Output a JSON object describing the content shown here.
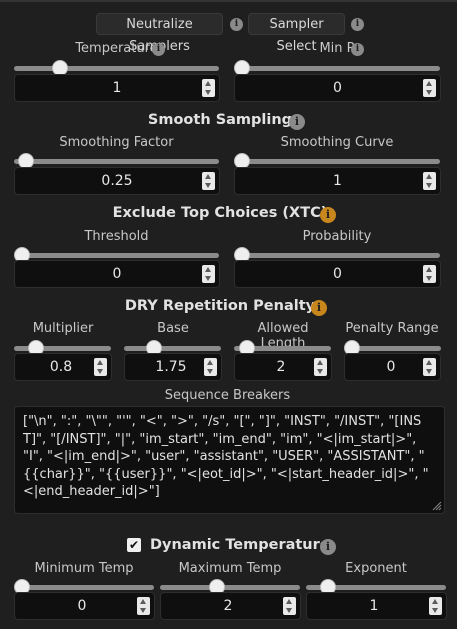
{
  "top_buttons": {
    "neutralize": "Neutralize Samplers",
    "sampler_select": "Sampler Select"
  },
  "basic": {
    "temperature": {
      "label": "Temperature",
      "value": "1"
    },
    "min_p": {
      "label": "Min P",
      "value": "0"
    }
  },
  "smooth": {
    "title": "Smooth Sampling",
    "factor": {
      "label": "Smoothing Factor",
      "value": "0.25"
    },
    "curve": {
      "label": "Smoothing Curve",
      "value": "1"
    }
  },
  "xtc": {
    "title": "Exclude Top Choices (XTC)",
    "threshold": {
      "label": "Threshold",
      "value": "0"
    },
    "probability": {
      "label": "Probability",
      "value": "0"
    }
  },
  "dry": {
    "title": "DRY Repetition Penalty",
    "multiplier": {
      "label": "Multiplier",
      "value": "0.8"
    },
    "base": {
      "label": "Base",
      "value": "1.75"
    },
    "allowed_length": {
      "label": "Allowed Length",
      "value": "2"
    },
    "penalty_range": {
      "label": "Penalty Range",
      "value": "0"
    },
    "sequence_breakers_label": "Sequence Breakers",
    "sequence_breakers": "[\"\\n\", \":\", \"\\\"\", \"'\", \"<\", \">\", \"/s\", \"[\", \"]\", \"INST\", \"/INST\", \"[INST]\", \"[/INST]\", \"|\", \"im_start\", \"im_end\", \"im\", \"<|im_start|>\",  \"I\", \"<|im_end|>\", \"user\", \"assistant\", \"USER\", \"ASSISTANT\", \"{{char}}\", \"{{user}}\", \"<|eot_id|>\", \"<|start_header_id|>\", \"<|end_header_id|>\"]"
  },
  "dynamic_temp": {
    "title": "Dynamic Temperature",
    "enabled": true,
    "check_glyph": "✔",
    "min": {
      "label": "Minimum Temp",
      "value": "0"
    },
    "max": {
      "label": "Maximum Temp",
      "value": "2"
    },
    "exponent": {
      "label": "Exponent",
      "value": "1"
    }
  },
  "icons": {
    "info_glyph": "i",
    "info_color": "#8a8a8a",
    "warn_color": "#c8871c"
  }
}
